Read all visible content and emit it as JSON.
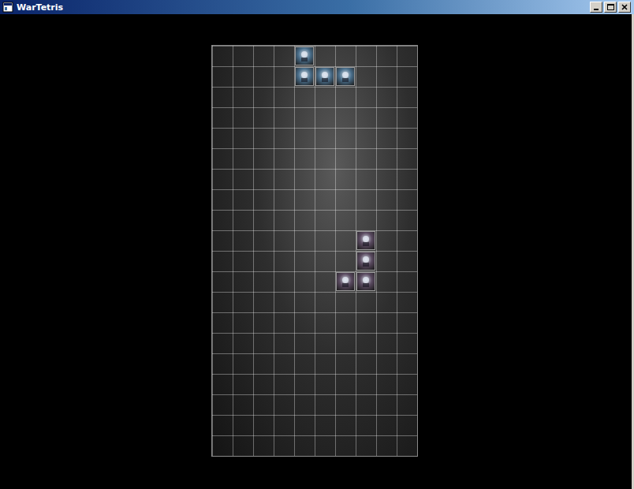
{
  "window": {
    "title": "WarTetris"
  },
  "board": {
    "columns": 10,
    "rows": 20,
    "cells": [
      {
        "col": 4,
        "row": 0,
        "color": "#4a6f8c"
      },
      {
        "col": 4,
        "row": 1,
        "color": "#4a6f8c"
      },
      {
        "col": 5,
        "row": 1,
        "color": "#4a6f8c"
      },
      {
        "col": 6,
        "row": 1,
        "color": "#4a6f8c"
      },
      {
        "col": 7,
        "row": 9,
        "color": "#5a4a60"
      },
      {
        "col": 7,
        "row": 10,
        "color": "#5a4a60"
      },
      {
        "col": 7,
        "row": 11,
        "color": "#5a4a60"
      },
      {
        "col": 6,
        "row": 11,
        "color": "#5a4a60"
      }
    ]
  }
}
